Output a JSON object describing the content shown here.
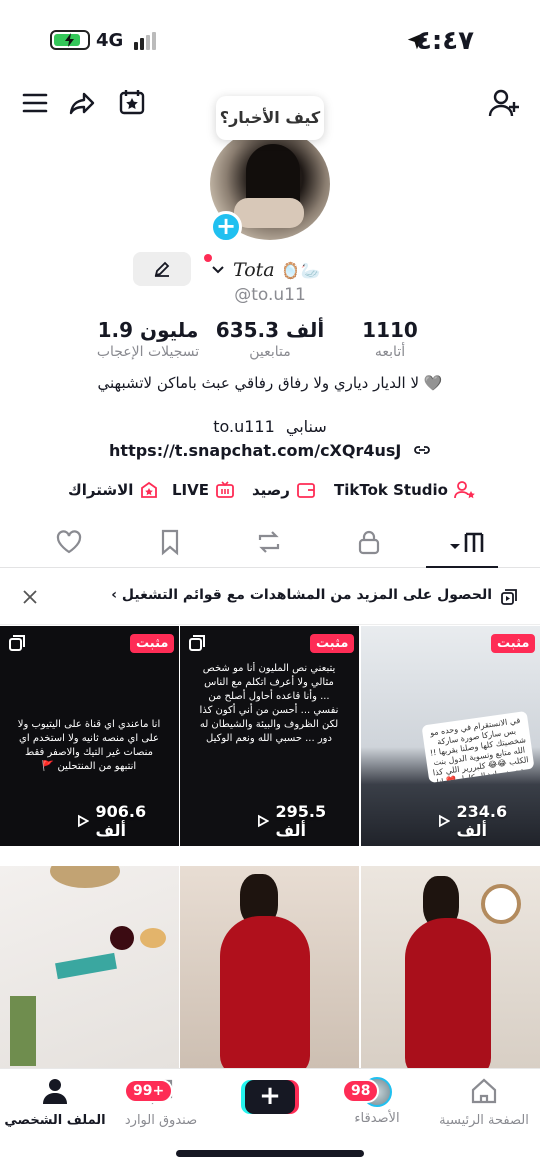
{
  "status_bar": {
    "time": "٤:٤٧",
    "network": "4G"
  },
  "bubble": {
    "text": "كيف الأخبار؟"
  },
  "profile": {
    "nickname": "Tota",
    "nickname_emoji": "🪞🦢",
    "username": "@to.u11",
    "stats": [
      {
        "value": "1110",
        "label": "أتابعه"
      },
      {
        "value": "635.3 ألف",
        "label": "متابعين"
      },
      {
        "value": "1.9 مليون",
        "label": "تسجيلات الإعجاب"
      }
    ],
    "bio": "لا الديار دياري ولا رفاق رفاقي عبث باماكن لاتشبهني 🩶",
    "snap_label": "سنابي",
    "snap_value": "to.u111",
    "link": "https://t.snapchat.com/cXQr4usJ"
  },
  "chips": {
    "studio": "TikTok Studio",
    "balance": "رصيد",
    "live": "LIVE",
    "subscribe": "الاشتراك"
  },
  "banner": {
    "text": "الحصول على المزيد من المشاهدات مع قوائم التشغيل ›"
  },
  "videos": [
    {
      "pinned": true,
      "pin_label": "مثبت",
      "views": "234.6 ألف",
      "caption": "في الانستقرام في وحده مو بس ساركا صورة ساركة شخصيتك كلها وصلنا يقربها !! الله متابع وتسوية الدول بنت الكلب 😂😂 كلبررير اللي كذا متحميني انشال كامل ❤️ انا بس استخدم سناب وتيك توك فقط ...",
      "multi": true
    },
    {
      "pinned": true,
      "pin_label": "مثبت",
      "views": "295.5 ألف",
      "caption": "يتبعني نص المليون أنا مو شخص مثالي ولا أعرف اتكلم مع الناس ... وأنا قاعده أحاول أصلح من نفسي ... أحسن من أني أكون كذا لكن الظروف والبيئة والشيطان له دور ... حسبي الله ونعم الوكيل",
      "multi": true
    },
    {
      "pinned": true,
      "pin_label": "مثبت",
      "views": "906.6 ألف",
      "caption": "انا ماعندي اي قناة على اليتيوب ولا على اي منصه ثانيه ولا استخدم اي منصات غير التيك والاصفر فقط انتبهو من المنتحلين 🚩",
      "multi": true
    },
    {
      "pinned": false,
      "views": "",
      "multi": false
    },
    {
      "pinned": false,
      "views": "",
      "multi": false
    },
    {
      "pinned": false,
      "views": "",
      "multi": false
    }
  ],
  "bottom_nav": {
    "home": "الصفحة الرئيسية",
    "friends": "الأصدقاء",
    "friends_badge": "98",
    "inbox": "صندوق الوارد",
    "inbox_badge": "99+",
    "profile": "الملف الشخصي"
  },
  "colors": {
    "accent": "#fe2c55",
    "cyan": "#20c0f0",
    "text": "#161823",
    "muted": "#8a8b91"
  }
}
